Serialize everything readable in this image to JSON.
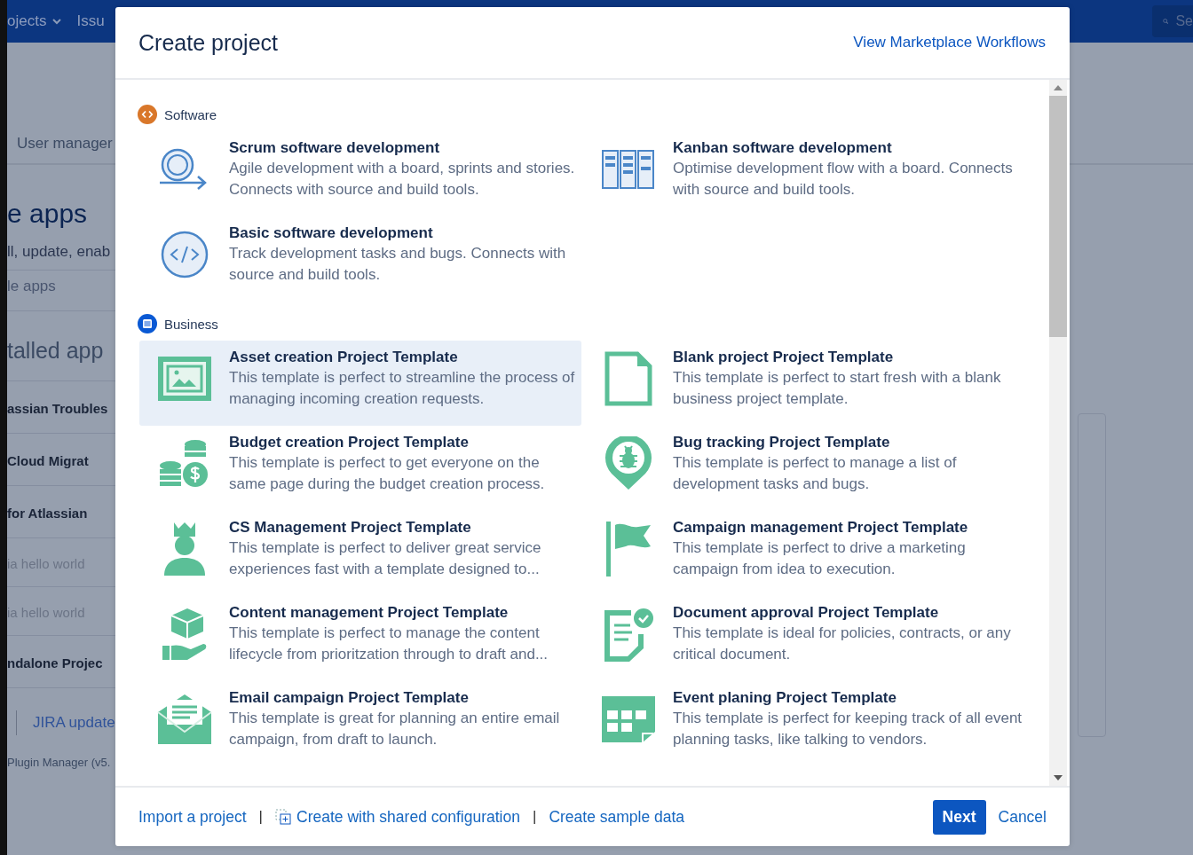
{
  "background": {
    "nav": [
      {
        "label": "ojects",
        "has_menu": true
      },
      {
        "label": "Issu",
        "has_menu": false
      }
    ],
    "search": {
      "placeholder": "Se"
    },
    "subnav": "User manager",
    "heading": "e apps",
    "subtitle": "ll, update, enab",
    "filter": "le apps",
    "section": "talled app",
    "apps": [
      {
        "name": "assian Troubles",
        "disabled": false
      },
      {
        "name": "Cloud Migrat",
        "disabled": false
      },
      {
        "name": "for Atlassian",
        "disabled": false
      },
      {
        "name": "ia hello world",
        "disabled": true
      },
      {
        "name": "ia hello world",
        "disabled": true
      },
      {
        "name": "ndalone Projec",
        "disabled": false
      }
    ],
    "link": "JIRA update",
    "footer": "Plugin Manager (v5."
  },
  "modal": {
    "title": "Create project",
    "header_link": "View Marketplace Workflows",
    "sections": [
      {
        "name": "Software",
        "templates": [
          {
            "title": "Scrum software development",
            "description": "Agile development with a board, sprints and stories. Connects with source and build tools.",
            "selected": false
          },
          {
            "title": "Kanban software development",
            "description": "Optimise development flow with a board. Connects with source and build tools.",
            "selected": false
          },
          {
            "title": "Basic software development",
            "description": "Track development tasks and bugs. Connects with source and build tools.",
            "selected": false
          }
        ]
      },
      {
        "name": "Business",
        "templates": [
          {
            "title": "Asset creation Project Template",
            "description": "This template is perfect to streamline the process of managing incoming creation requests.",
            "selected": true
          },
          {
            "title": "Blank project Project Template",
            "description": "This template is perfect to start fresh with a blank business project template.",
            "selected": false
          },
          {
            "title": "Budget creation Project Template",
            "description": "This template is perfect to get everyone on the same page during the budget creation process.",
            "selected": false
          },
          {
            "title": "Bug tracking Project Template",
            "description": "This template is perfect to manage a list of development tasks and bugs.",
            "selected": false
          },
          {
            "title": "CS Management Project Template",
            "description": "This template is perfect to deliver great service experiences fast with a template designed to...",
            "selected": false
          },
          {
            "title": "Campaign management Project Template",
            "description": "This template is perfect to drive a marketing campaign from idea to execution.",
            "selected": false
          },
          {
            "title": "Content management Project Template",
            "description": "This template is perfect to manage the content lifecycle from prioritzation through to draft and...",
            "selected": false
          },
          {
            "title": "Document approval Project Template",
            "description": "This template is ideal for policies, contracts, or any critical document.",
            "selected": false
          },
          {
            "title": "Email campaign Project Template",
            "description": "This template is great for planning an entire email campaign, from draft to launch.",
            "selected": false
          },
          {
            "title": "Event planing Project Template",
            "description": "This template is perfect for keeping track of all event planning tasks, like talking to vendors.",
            "selected": false
          }
        ]
      }
    ],
    "footer_links": [
      "Import a project",
      "Create with shared configuration",
      "Create sample data"
    ],
    "separator": "|",
    "primary_button": "Next",
    "cancel_button": "Cancel"
  }
}
